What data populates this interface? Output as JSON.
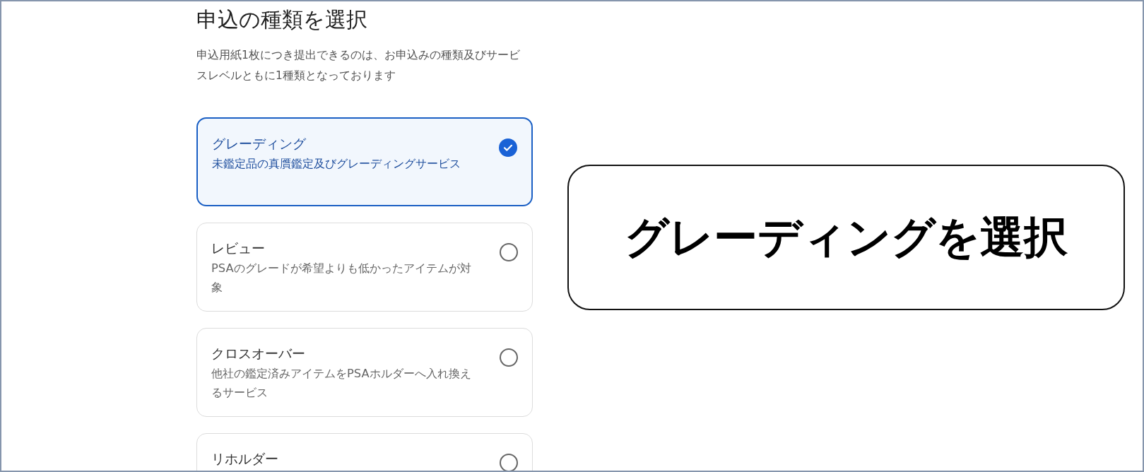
{
  "title": "申込の種類を選択",
  "description": "申込用紙1枚につき提出できるのは、お申込みの種類及びサービスレベルともに1種類となっております",
  "options": [
    {
      "title": "グレーディング",
      "description": "未鑑定品の真贋鑑定及びグレーディングサービス",
      "selected": true
    },
    {
      "title": "レビュー",
      "description": "PSAのグレードが希望よりも低かったアイテムが対象",
      "selected": false
    },
    {
      "title": "クロスオーバー",
      "description": "他社の鑑定済みアイテムをPSAホルダーへ入れ換えるサービス",
      "selected": false
    },
    {
      "title": "リホルダー",
      "selected": false
    }
  ],
  "callout": {
    "text": "グレーディングを選択"
  }
}
